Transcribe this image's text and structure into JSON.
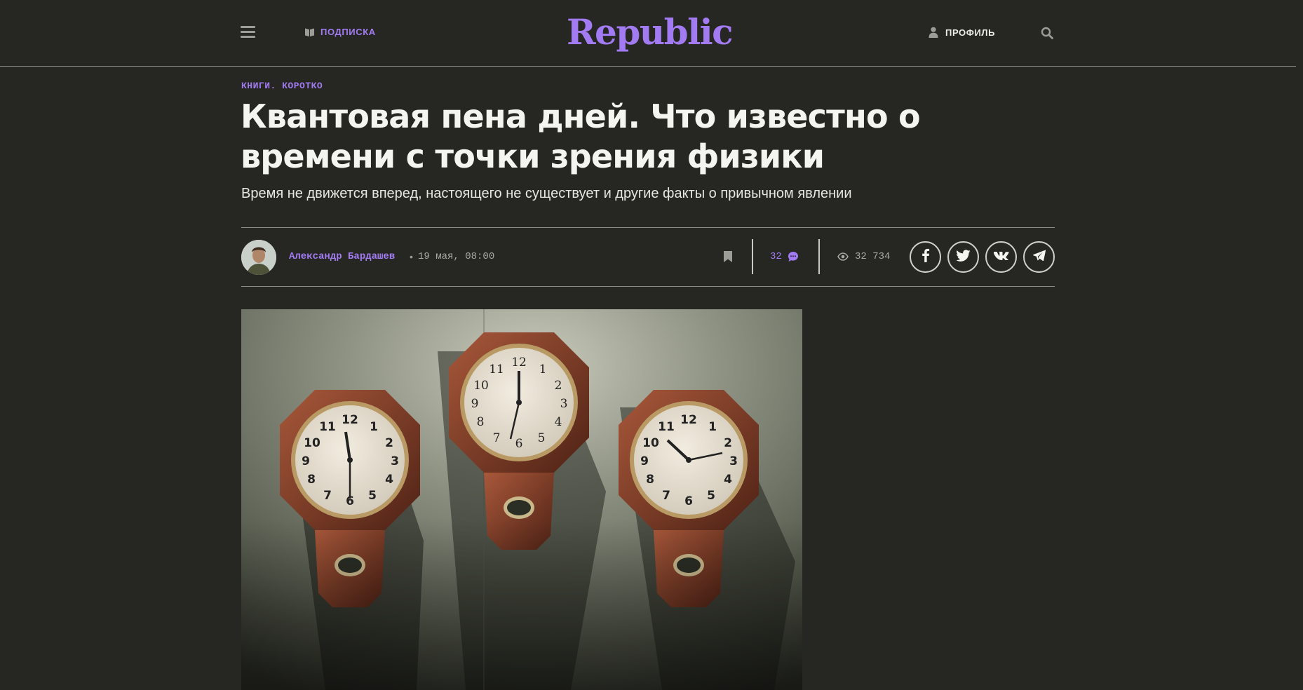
{
  "header": {
    "subscribe_label": "ПОДПИСКА",
    "logo_text": "Republic",
    "profile_label": "ПРОФИЛЬ"
  },
  "article": {
    "rubric": "КНИГИ. КОРОТКО",
    "title": "Квантовая пена дней. Что известно о времени с точки зрения физики",
    "lead": "Время не движется вперед, настоящего не существует и другие факты о привычном явлении",
    "author": "Александр Бардашев",
    "separator": "•",
    "date": "19 мая, 08:00",
    "comments_count": "32",
    "views_count": "32 734"
  },
  "share": [
    "facebook",
    "twitter",
    "vk",
    "telegram"
  ],
  "colors": {
    "background": "#262622",
    "accent": "#a27bf2",
    "text": "#f4f4f0",
    "muted": "#a9a9a4"
  }
}
